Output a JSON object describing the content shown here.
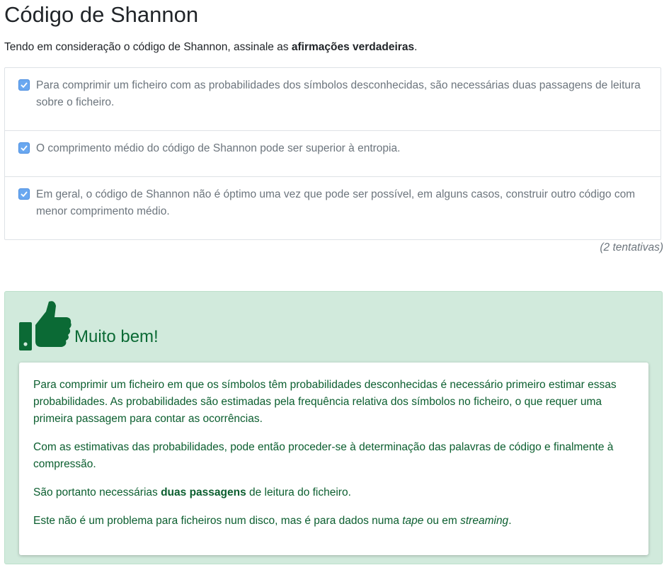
{
  "page": {
    "title": "Código de Shannon",
    "prompt_text": "Tendo em consideração o código de Shannon, assinale as ",
    "prompt_bold": "afirmações verdadeiras",
    "prompt_end": "."
  },
  "options": [
    {
      "label": "Para comprimir um ficheiro com as probabilidades dos símbolos desconhecidas, são necessárias duas passagens de leitura sobre o ficheiro.",
      "checked": true
    },
    {
      "label": "O comprimento médio do código de Shannon pode ser superior à entropia.",
      "checked": true
    },
    {
      "label": "Em geral, o código de Shannon não é óptimo uma vez que pode ser possível, em alguns casos, construir outro código com menor comprimento médio.",
      "checked": true
    }
  ],
  "attempts": "(2 tentativas)",
  "feedback": {
    "icon": "thumbs-up-icon",
    "title": "Muito bem!",
    "p1": "Para comprimir um ficheiro em que os símbolos têm probabilidades desconhecidas é necessário primeiro estimar essas probabilidades. As probabilidades são estimadas pela frequência relativa dos símbolos no ficheiro, o que requer uma primeira passagem para contar as ocorrências.",
    "p2": "Com as estimativas das probabilidades, pode então proceder-se à determinação das palavras de código e finalmente à compressão.",
    "p3_pre": "São portanto necessárias ",
    "p3_bold": "duas passagens",
    "p3_post": " de leitura do ficheiro.",
    "p4_pre": "Este não é um problema para ficheiros num disco, mas é para dados numa ",
    "p4_i1": "tape",
    "p4_mid": " ou em ",
    "p4_i2": "streaming",
    "p4_end": "."
  },
  "colors": {
    "checkbox": "#6aa8f0",
    "feedback_bg": "#d1eadc",
    "feedback_text": "#0b5e2f",
    "thumb": "#0b6a35"
  }
}
